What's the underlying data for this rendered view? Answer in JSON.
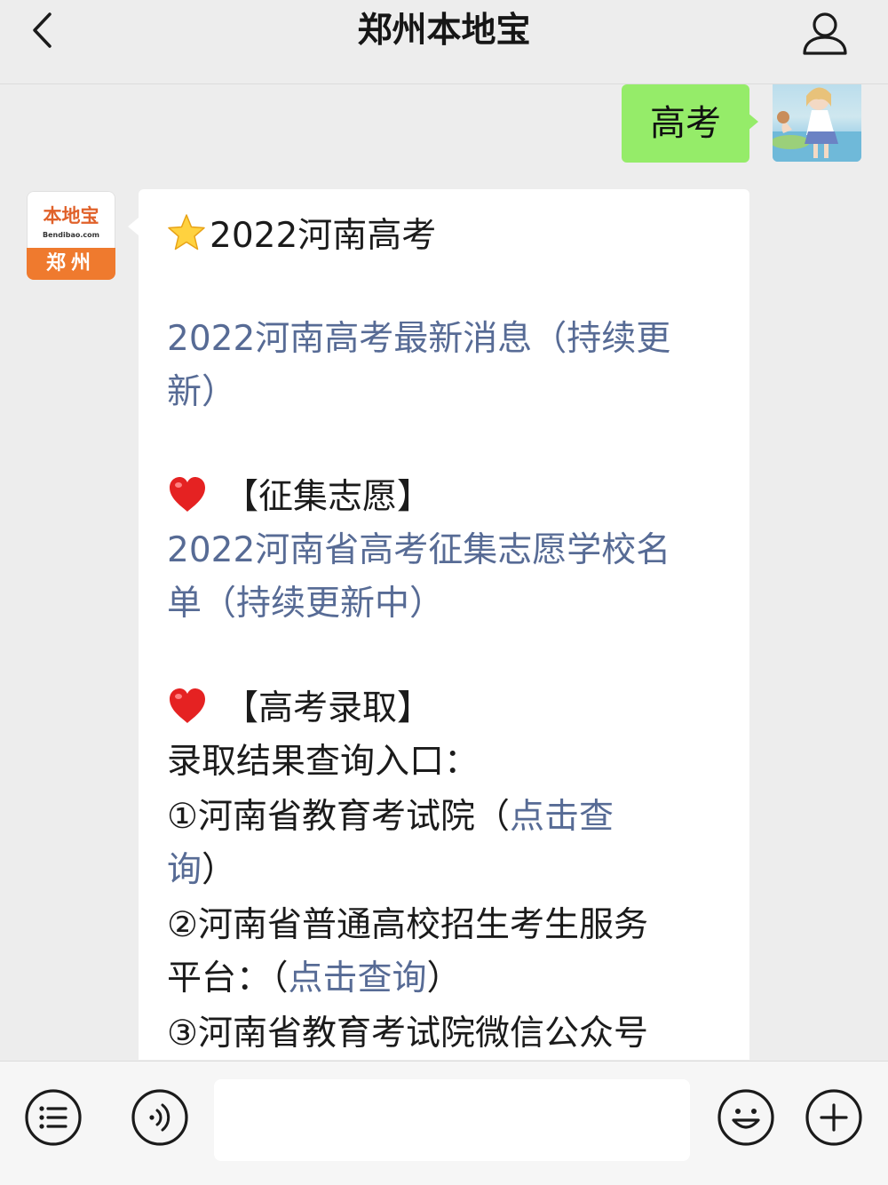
{
  "header": {
    "title": "郑州本地宝"
  },
  "outgoing": {
    "text": "高考"
  },
  "account_avatar": {
    "brand": "本地宝",
    "url": "Bendibao.com",
    "city": "郑州"
  },
  "message": {
    "title": "2022河南高考",
    "latest_link": "2022河南高考最新消息（持续更",
    "latest_link_cont": "新）",
    "section1": "【征集志愿】",
    "section1_link": "2022河南省高考征集志愿学校名",
    "section1_link_cont": "单（持续更新中）",
    "section2": "【高考录取】",
    "query_entry": "录取结果查询入口：",
    "item1_text": "①河南省教育考试院（",
    "item1_link": "点击查",
    "item1_link_cont": "询",
    "item1_close": "）",
    "item2_text": "②河南省普通高校招生考生服务",
    "item2_text_cont": "平台：（",
    "item2_link": "点击查询",
    "item2_close": "）",
    "item3_text": "③河南省教育考试院微信公众号"
  },
  "bottom_bar": {
    "input_placeholder": ""
  },
  "icons": {
    "back": "chevron-left-icon",
    "user": "user-icon",
    "menu": "list-menu-icon",
    "voice": "voice-icon",
    "emoji": "smiley-icon",
    "add": "plus-icon",
    "star": "star-icon",
    "heart": "heart-icon"
  },
  "colors": {
    "background": "#ededed",
    "outgoing_bubble": "#95ec69",
    "incoming_bubble": "#ffffff",
    "link": "#576b95",
    "city_badge": "#ef7a2e"
  }
}
